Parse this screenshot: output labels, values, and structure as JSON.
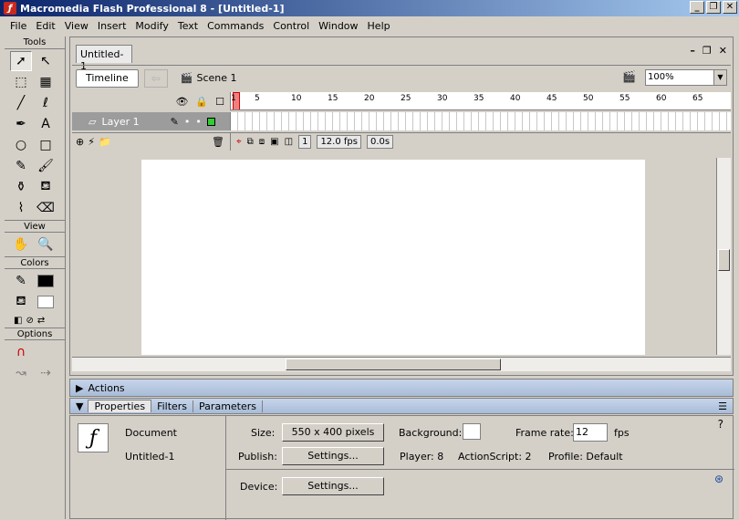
{
  "window": {
    "title": "Macromedia Flash Professional 8 - [Untitled-1]",
    "icon": "flash-app-icon"
  },
  "menu": [
    "File",
    "Edit",
    "View",
    "Insert",
    "Modify",
    "Text",
    "Commands",
    "Control",
    "Window",
    "Help"
  ],
  "tools": {
    "title": "Tools",
    "view_title": "View",
    "colors_title": "Colors",
    "options_title": "Options"
  },
  "document": {
    "tab": "Untitled-1",
    "timeline_label": "Timeline",
    "scene": "Scene 1",
    "zoom": "100%"
  },
  "timeline": {
    "layer": "Layer 1",
    "ruler": [
      "1",
      "5",
      "10",
      "15",
      "20",
      "25",
      "30",
      "35",
      "40",
      "45",
      "50",
      "55",
      "60",
      "65"
    ],
    "frame": "1",
    "fps": "12.0 fps",
    "time": "0.0s"
  },
  "panels": {
    "actions": "Actions",
    "tabs": [
      "Properties",
      "Filters",
      "Parameters"
    ]
  },
  "properties": {
    "doc_label": "Document",
    "doc_name": "Untitled-1",
    "size_label": "Size:",
    "size_value": "550 x 400 pixels",
    "publish_label": "Publish:",
    "settings": "Settings...",
    "background_label": "Background:",
    "framerate_label": "Frame rate:",
    "framerate_value": "12",
    "fps_unit": "fps",
    "player": "Player: 8",
    "actionscript": "ActionScript: 2",
    "profile": "Profile: Default",
    "device_label": "Device:"
  }
}
